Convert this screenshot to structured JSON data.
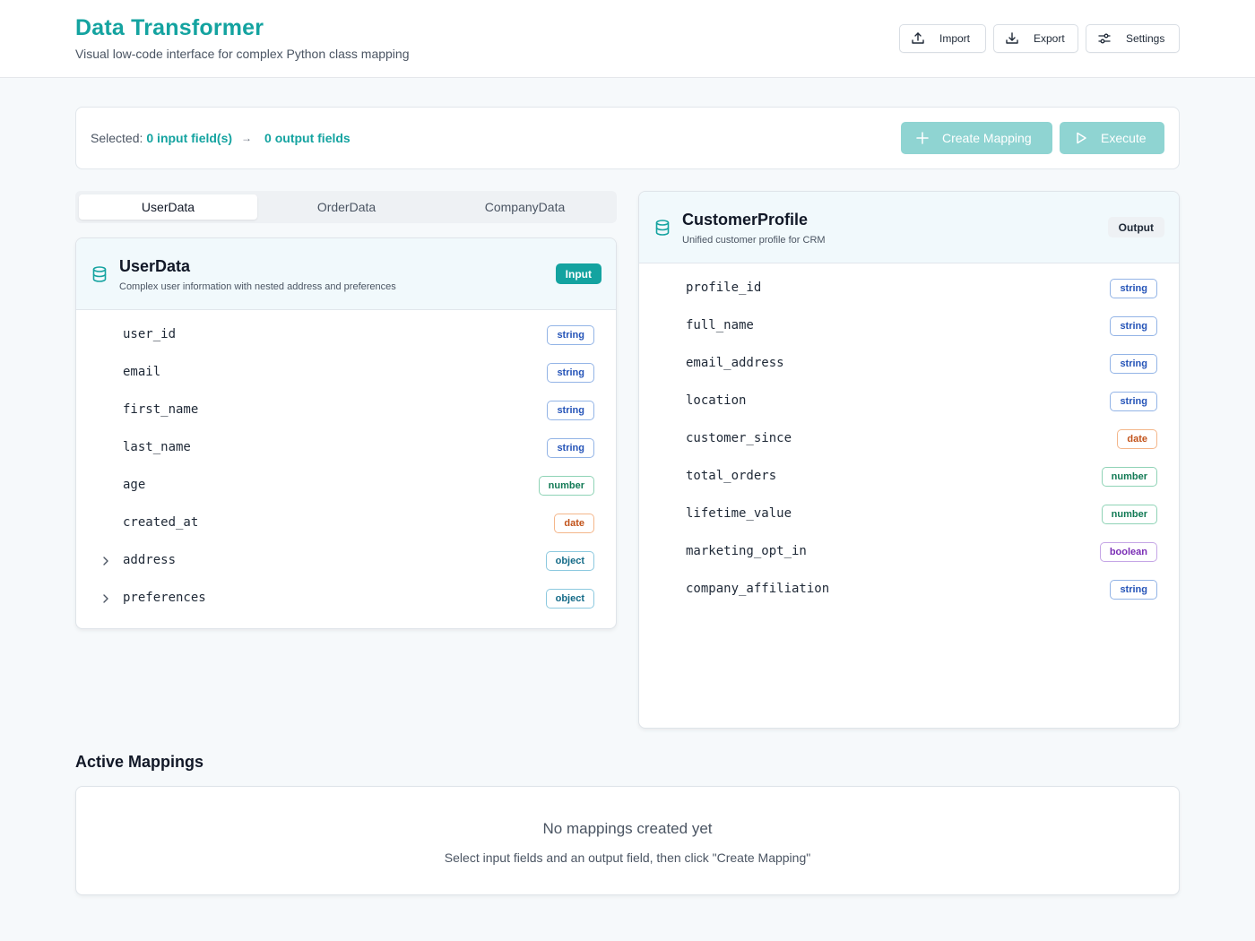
{
  "header": {
    "title": "Data Transformer",
    "subtitle": "Visual low-code interface for complex Python class mapping",
    "import_label": "Import",
    "export_label": "Export",
    "settings_label": "Settings"
  },
  "selection": {
    "prefix": "Selected:",
    "input_count": "0 input field(s)",
    "arrow": "→",
    "output_count": "0 output fields",
    "create_label": "Create Mapping",
    "execute_label": "Execute"
  },
  "tabs": [
    {
      "label": "UserData",
      "active": true
    },
    {
      "label": "OrderData",
      "active": false
    },
    {
      "label": "CompanyData",
      "active": false
    }
  ],
  "input_card": {
    "title": "UserData",
    "subtitle": "Complex user information with nested address and preferences",
    "badge": "Input",
    "fields": [
      {
        "name": "user_id",
        "type": "string",
        "expandable": false
      },
      {
        "name": "email",
        "type": "string",
        "expandable": false
      },
      {
        "name": "first_name",
        "type": "string",
        "expandable": false
      },
      {
        "name": "last_name",
        "type": "string",
        "expandable": false
      },
      {
        "name": "age",
        "type": "number",
        "expandable": false
      },
      {
        "name": "created_at",
        "type": "date",
        "expandable": false
      },
      {
        "name": "address",
        "type": "object",
        "expandable": true
      },
      {
        "name": "preferences",
        "type": "object",
        "expandable": true
      }
    ]
  },
  "output_card": {
    "title": "CustomerProfile",
    "subtitle": "Unified customer profile for CRM",
    "badge": "Output",
    "fields": [
      {
        "name": "profile_id",
        "type": "string"
      },
      {
        "name": "full_name",
        "type": "string"
      },
      {
        "name": "email_address",
        "type": "string"
      },
      {
        "name": "location",
        "type": "string"
      },
      {
        "name": "customer_since",
        "type": "date"
      },
      {
        "name": "total_orders",
        "type": "number"
      },
      {
        "name": "lifetime_value",
        "type": "number"
      },
      {
        "name": "marketing_opt_in",
        "type": "boolean"
      },
      {
        "name": "company_affiliation",
        "type": "string"
      }
    ]
  },
  "mappings": {
    "section_title": "Active Mappings",
    "empty_title": "No mappings created yet",
    "empty_subtitle": "Select input fields and an output field, then click \"Create Mapping\""
  },
  "icons": {
    "import": "upload-icon",
    "export": "download-icon",
    "settings": "sliders-icon",
    "create": "plus-icon",
    "execute": "play-icon",
    "schema": "database-icon",
    "expand": "chevron-right-icon"
  },
  "colors": {
    "accent": "#14a3a0",
    "accent_disabled": "#8fd4d2"
  }
}
